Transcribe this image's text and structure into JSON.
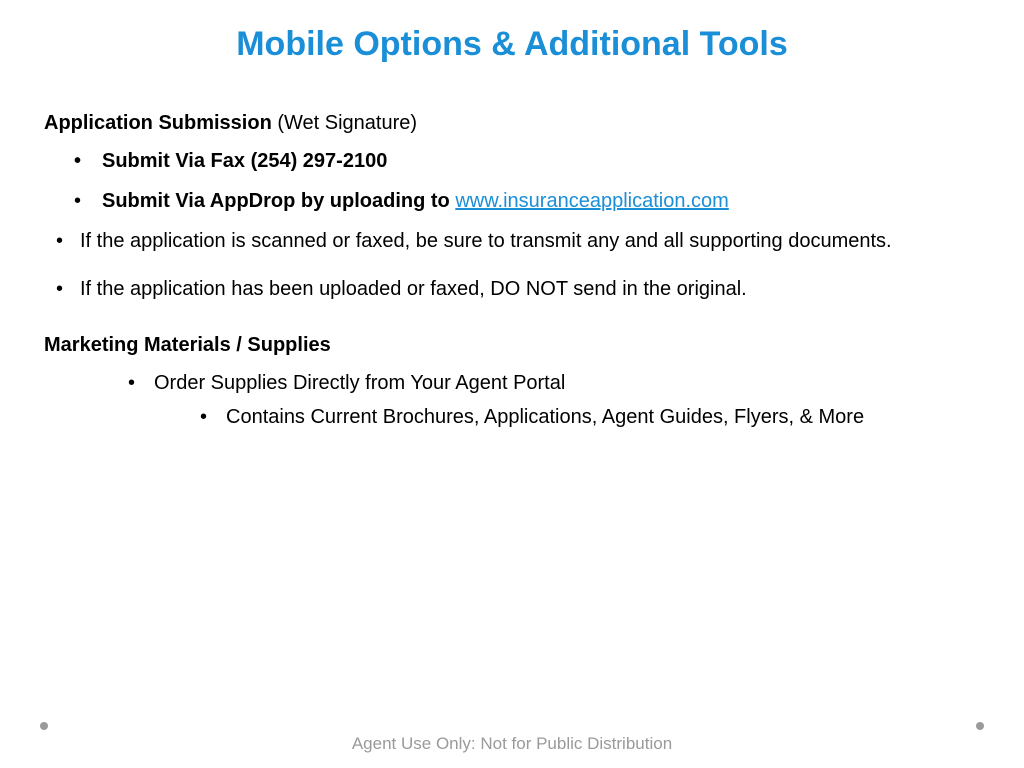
{
  "title": "Mobile Options & Additional Tools",
  "section1": {
    "head_bold": "Application Submission",
    "head_rest": " (Wet Signature)",
    "bullets_bold": [
      "Submit Via Fax (254) 297-2100",
      "Submit Via AppDrop by uploading to "
    ],
    "link_text": "www.insuranceapplication.com",
    "notes": [
      "If the application is scanned or faxed, be sure to transmit any and all supporting documents.",
      "If the application has been uploaded or faxed, DO NOT send in the original."
    ]
  },
  "section2": {
    "head": "Marketing Materials / Supplies",
    "item": "Order Supplies Directly from Your Agent Portal",
    "sub": "Contains Current Brochures, Applications, Agent Guides, Flyers, & More"
  },
  "footer": "Agent Use Only: Not for Public Distribution"
}
